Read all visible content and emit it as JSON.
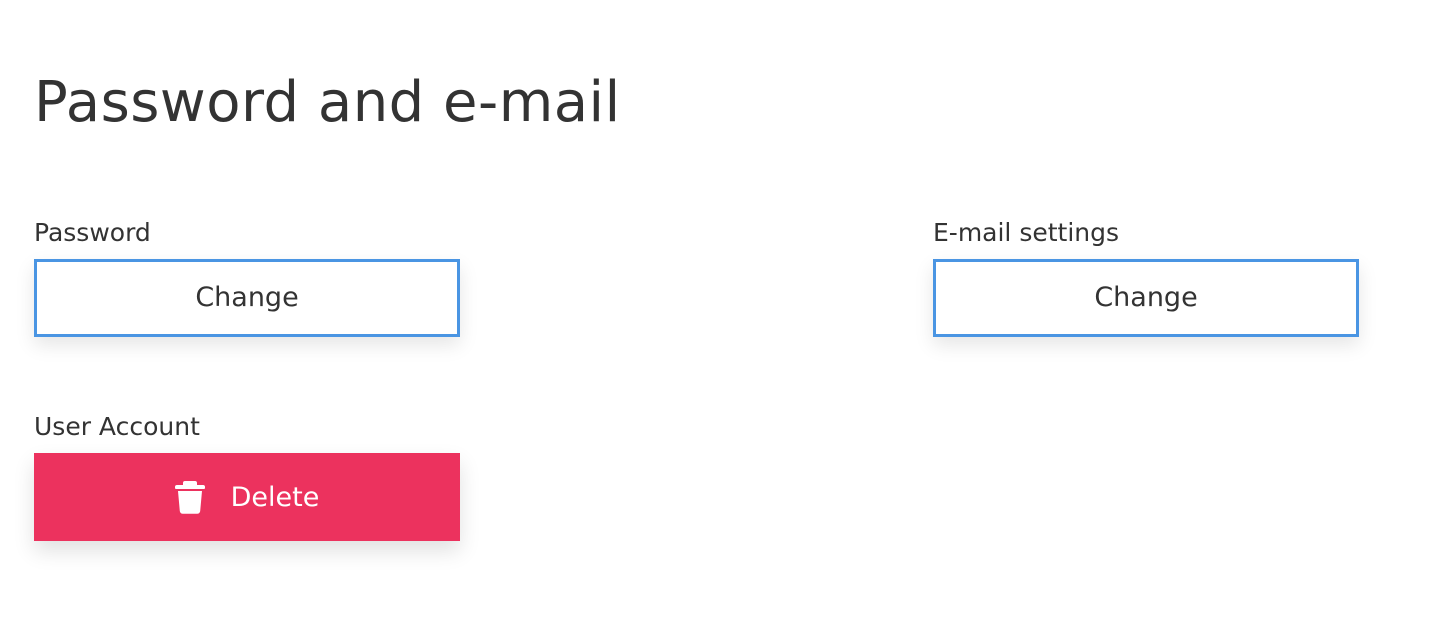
{
  "page": {
    "title": "Password and e-mail"
  },
  "password": {
    "label": "Password",
    "button_label": "Change"
  },
  "email": {
    "label": "E-mail settings",
    "button_label": "Change"
  },
  "account": {
    "label": "User Account",
    "button_label": "Delete",
    "button_icon": "trash-icon"
  },
  "colors": {
    "outline_border": "#4a95e3",
    "danger": "#ec325e",
    "text": "#333333",
    "background": "#ffffff"
  }
}
